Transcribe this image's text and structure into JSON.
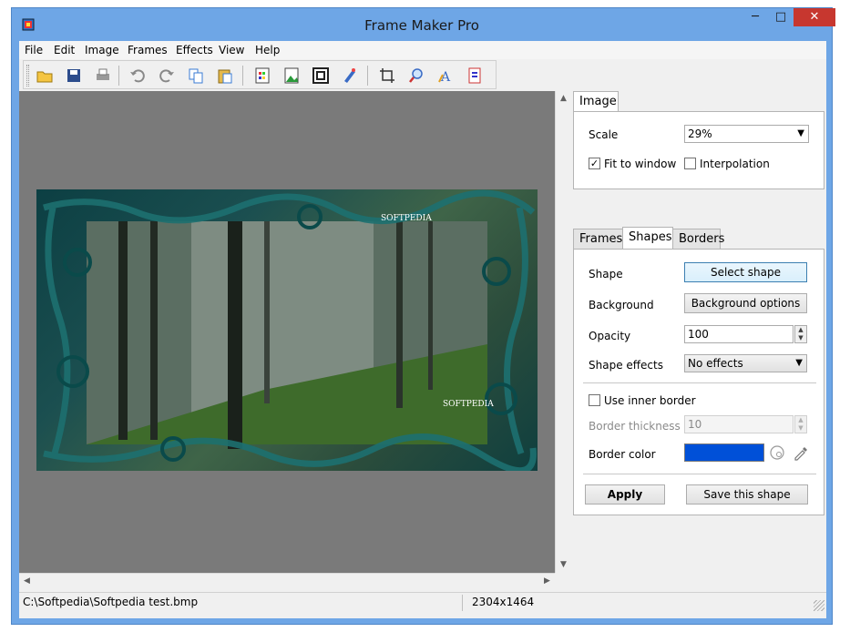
{
  "window": {
    "title": "Frame Maker Pro",
    "minimize": "─",
    "maximize": "□",
    "close": "✕"
  },
  "menu": [
    "File",
    "Edit",
    "Image",
    "Frames",
    "Effects",
    "View",
    "Help"
  ],
  "toolbar": {
    "icons": [
      "open-icon",
      "save-icon",
      "print-icon",
      "undo-icon",
      "redo-icon",
      "copy-icon",
      "paste-icon",
      "frame-icon",
      "image-icon",
      "border-icon",
      "effects-icon",
      "crop-icon",
      "zoom-icon",
      "text-icon",
      "info-icon"
    ]
  },
  "image": {
    "watermark_top": "SOFTPEDIA",
    "watermark_bottom": "SOFTPEDIA"
  },
  "status": {
    "path": "C:\\Softpedia\\Softpedia test.bmp",
    "dimensions": "2304x1464"
  },
  "panel": {
    "top_tab": "Image",
    "scale_label": "Scale",
    "scale_value": "29%",
    "fit_to_window": "Fit to window",
    "fit_checked": "✓",
    "interpolation": "Interpolation",
    "tabs": [
      "Frames",
      "Shapes",
      "Borders"
    ],
    "shape_label": "Shape",
    "select_shape": "Select shape",
    "background_label": "Background",
    "background_options": "Background options",
    "opacity_label": "Opacity",
    "opacity_value": "100",
    "shape_effects_label": "Shape effects",
    "shape_effects_value": "No effects",
    "use_inner_border": "Use inner border",
    "border_thickness_label": "Border thickness",
    "border_thickness_value": "10",
    "border_color_label": "Border color",
    "border_color": "#0050d8",
    "apply": "Apply",
    "save_shape": "Save this shape"
  }
}
